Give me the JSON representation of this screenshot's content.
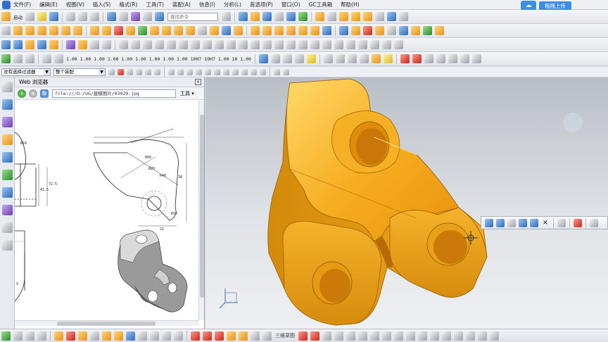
{
  "menu": {
    "items": [
      "文件(F)",
      "编辑(E)",
      "视图(V)",
      "插入(S)",
      "格式(R)",
      "工具(T)",
      "装配(A)",
      "信息(I)",
      "分析(L)",
      "首选项(P)",
      "窗口(O)",
      "GC工具箱",
      "帮助(H)"
    ]
  },
  "cloud": {
    "label": "拖拽上传"
  },
  "toolbar": {
    "start_label": "启动",
    "search_placeholder": "查找命令",
    "values": [
      "1.00",
      "1.00\n1.00",
      "1.00\n1.00",
      "1.00\n1.00",
      "1.00",
      "1.00",
      "10H7",
      "10H7\n1.00",
      "10\n1.00"
    ],
    "filter_select": "没有选择过滤器",
    "scope_select": "整个装配"
  },
  "web_panel": {
    "title": "Web 浏览器",
    "url": "file:///D:/UG/建模图片/03029.jpg",
    "tools_label": "工具"
  },
  "drawing": {
    "dims": [
      "Ø24",
      "R60",
      "Ø20",
      "R40",
      "72.5",
      "41.5",
      "38",
      "21",
      "Ø14",
      "5"
    ]
  },
  "bottom": {
    "label": "三维草图"
  },
  "colors": {
    "part_face": "#f2a81a",
    "part_shadow": "#c97e0a",
    "background_top": "#b9bec5",
    "accent": "#3a8ee6"
  }
}
